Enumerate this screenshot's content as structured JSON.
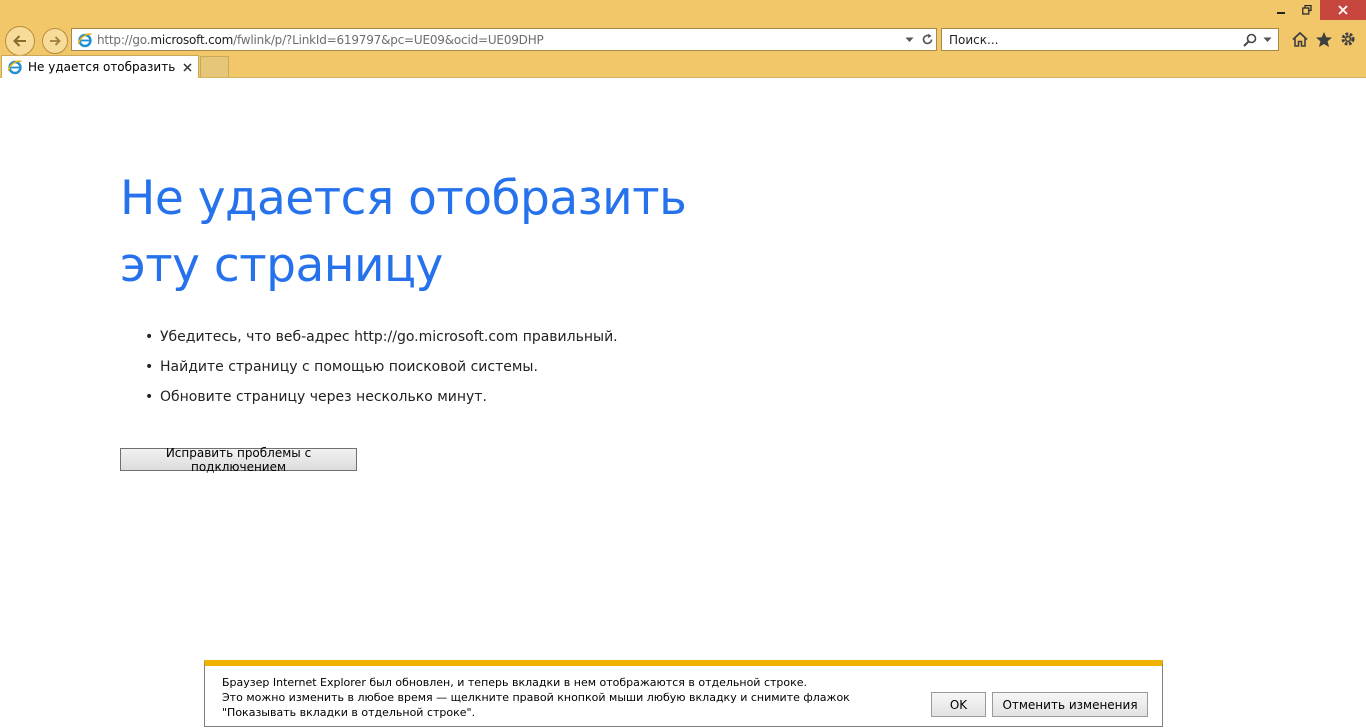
{
  "browser": {
    "address_bar": {
      "url_prefix": "http://go.",
      "url_host": "microsoft.com",
      "url_suffix": "/fwlink/p/?LinkId=619797&pc=UE09&ocid=UE09DHP"
    },
    "search": {
      "placeholder": "Поиск..."
    },
    "tabs": [
      {
        "title": "Не удается отобразить эту...",
        "active": true
      }
    ],
    "colors": {
      "chrome": "#f2c76a",
      "close_button": "#c7463d"
    }
  },
  "page": {
    "title": "Не удается отобразить эту страницу",
    "suggestions": [
      "Убедитесь, что веб-адрес http://go.microsoft.com правильный.",
      "Найдите страницу с помощью поисковой системы.",
      "Обновите страницу через несколько минут."
    ],
    "fix_button_label": "Исправить проблемы с подключением",
    "colors": {
      "title": "#2672ec"
    }
  },
  "notification": {
    "line1": "Браузер Internet Explorer был обновлен, и теперь вкладки в нем отображаются в отдельной строке.",
    "line2": "Это можно изменить в любое время — щелкните правой кнопкой мыши любую вкладку и снимите флажок \"Показывать вкладки в отдельной строке\".",
    "ok_label": "OK",
    "undo_label": "Отменить изменения",
    "colors": {
      "accent": "#f0b400"
    }
  },
  "icons": {
    "window": [
      "minimize-icon",
      "restore-icon",
      "close-icon"
    ],
    "navigation": [
      "back-arrow-icon",
      "forward-arrow-icon"
    ],
    "address": [
      "ie-logo-icon",
      "dropdown-arrow-icon",
      "refresh-icon"
    ],
    "search": [
      "magnifier-icon",
      "dropdown-arrow-icon"
    ],
    "commands": [
      "home-icon",
      "favorites-star-icon",
      "settings-gear-icon"
    ],
    "tab": [
      "ie-logo-icon",
      "close-icon"
    ]
  }
}
